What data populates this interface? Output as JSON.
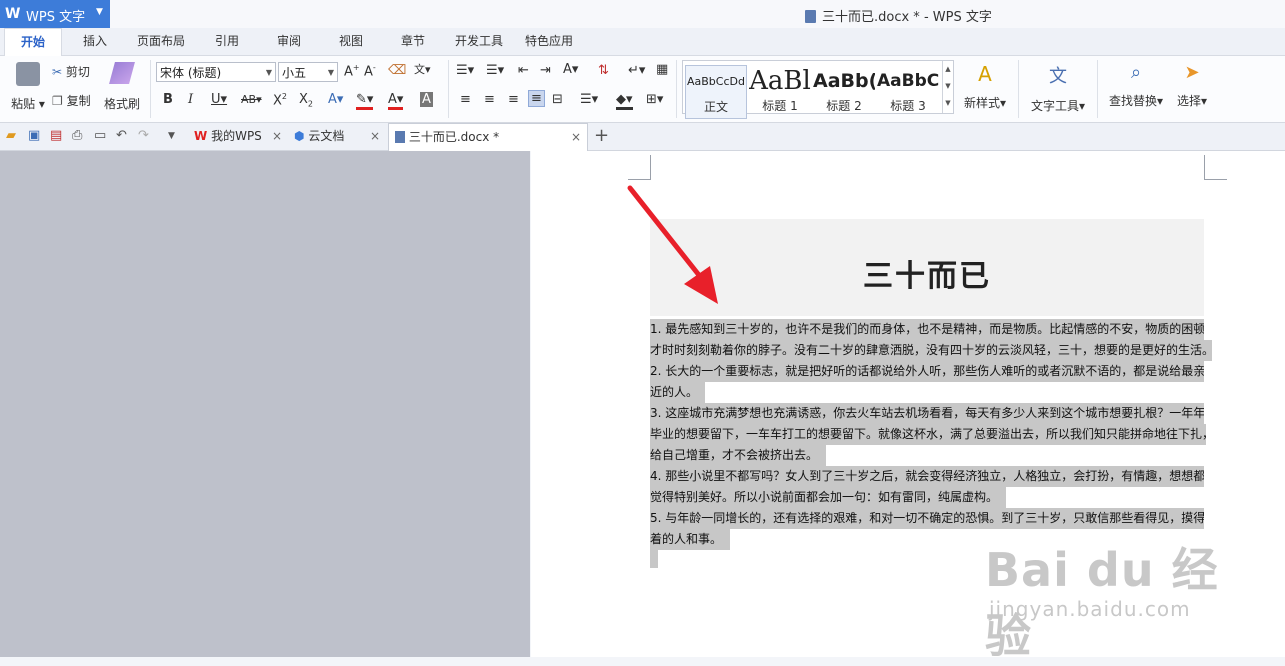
{
  "app": {
    "logo": "W",
    "name": "WPS 文字",
    "window_title": "三十而已.docx * - WPS 文字"
  },
  "menu_tabs": [
    "开始",
    "插入",
    "页面布局",
    "引用",
    "审阅",
    "视图",
    "章节",
    "开发工具",
    "特色应用"
  ],
  "ribbon": {
    "paste": "粘贴",
    "cut": "剪切",
    "copy": "复制",
    "format_painter": "格式刷",
    "font_name": "宋体 (标题)",
    "font_size": "小五",
    "styles": [
      {
        "preview": "AaBbCcDd",
        "label": "正文"
      },
      {
        "preview": "AaBl",
        "label": "标题 1"
      },
      {
        "preview": "AaBb(",
        "label": "标题 2"
      },
      {
        "preview": "AaBbC",
        "label": "标题 3"
      }
    ],
    "new_style": "新样式",
    "text_tools": "文字工具",
    "find_replace": "查找替换",
    "select": "选择"
  },
  "doc_tabs": [
    {
      "label": "我的WPS"
    },
    {
      "label": "云文档"
    },
    {
      "label": "三十而已.docx *"
    }
  ],
  "document": {
    "title": "三十而已",
    "lines": [
      "1.  最先感知到三十岁的，也许不是我们的而身体，也不是精神，而是物质。比起情感的不安，物质的困顿",
      "才时时刻刻勒着你的脖子。没有二十岁的肆意洒脱，没有四十岁的云淡风轻，三十，想要的是更好的生活。",
      "2.  长大的一个重要标志，就是把好听的话都说给外人听，那些伤人难听的或者沉默不语的，都是说给最亲",
      "近的人。",
      "3.  这座城市充满梦想也充满诱惑，你去火车站去机场看看，每天有多少人来到这个城市想要扎根？一年年",
      "毕业的想要留下，一车车打工的想要留下。就像这杯水，满了总要溢出去，所以我们知只能拼命地往下扎，",
      "给自己增重，才不会被挤出去。",
      "4.  那些小说里不都写吗？女人到了三十岁之后，就会变得经济独立，人格独立，会打扮，有情趣，想想都",
      "觉得特别美好。所以小说前面都会加一句：如有雷同，纯属虚构。",
      "5.  与年龄一同增长的，还有选择的艰难，和对一切不确定的恐惧。到了三十岁，只敢信那些看得见，摸得",
      "着的人和事。"
    ]
  },
  "watermark": {
    "brand": "Bai du 经验",
    "url": "jingyan.baidu.com"
  },
  "colors": {
    "accent": "#3d7cd9",
    "arrow": "#e8202a",
    "selection": "#c7c7c7",
    "gutter": "#bec1cb"
  }
}
